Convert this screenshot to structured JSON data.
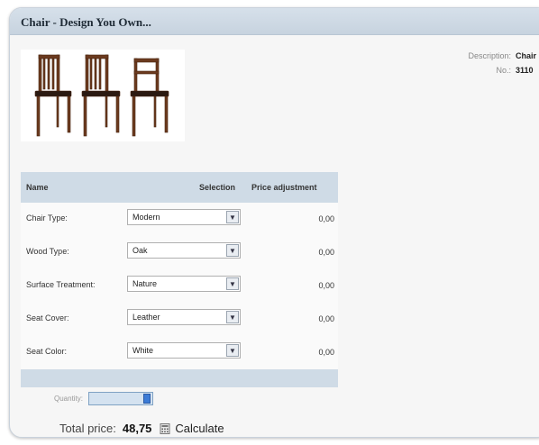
{
  "window": {
    "title": "Chair - Design You Own..."
  },
  "product": {
    "image_icon": "chairs-image",
    "meta": [
      {
        "label": "Description:",
        "value": "Chair"
      },
      {
        "label": "No.:",
        "value": "3110"
      }
    ]
  },
  "options": {
    "headers": {
      "name": "Name",
      "selection": "Selection",
      "price": "Price adjustment"
    },
    "rows": [
      {
        "label": "Chair Type:",
        "selected": "Modern",
        "price": "0,00"
      },
      {
        "label": "Wood Type:",
        "selected": "Oak",
        "price": "0,00"
      },
      {
        "label": "Surface Treatment:",
        "selected": "Nature",
        "price": "0,00"
      },
      {
        "label": "Seat Cover:",
        "selected": "Leather",
        "price": "0,00"
      },
      {
        "label": "Seat Color:",
        "selected": "White",
        "price": "0,00"
      }
    ]
  },
  "quantity": {
    "label": "Quantity:",
    "value": ""
  },
  "total": {
    "label": "Total price:",
    "value": "48,75",
    "calculate_label": "Calculate",
    "calculate_icon": "calculator-icon"
  },
  "colors": {
    "header_bg": "#cfdbe6",
    "titlebar_bg": "#c7d3df",
    "wood": "#6b3a1f",
    "accent": "#3c7bd6"
  }
}
